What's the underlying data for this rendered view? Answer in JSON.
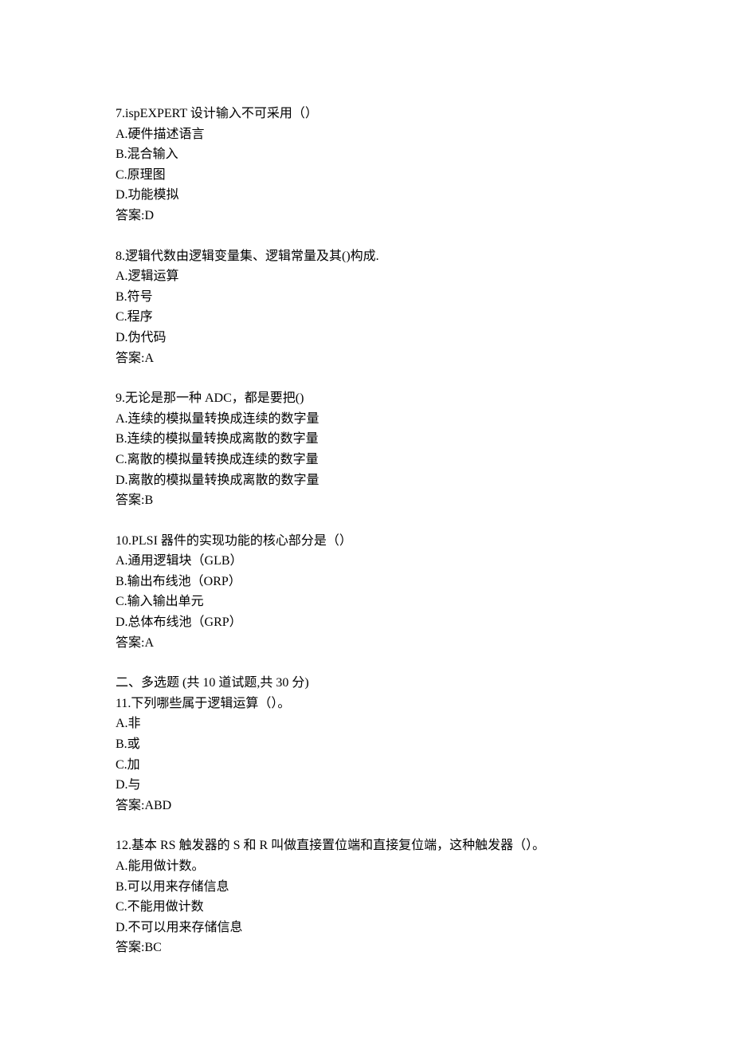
{
  "questions": [
    {
      "number": "7",
      "stem": "7.ispEXPERT 设计输入不可采用（）",
      "options": [
        "A.硬件描述语言",
        "B.混合输入",
        "C.原理图",
        "D.功能模拟"
      ],
      "answer_label": "答案:D"
    },
    {
      "number": "8",
      "stem": "8.逻辑代数由逻辑变量集、逻辑常量及其()构成.",
      "options": [
        "A.逻辑运算",
        "B.符号",
        "C.程序",
        "D.伪代码"
      ],
      "answer_label": "答案:A"
    },
    {
      "number": "9",
      "stem": "9.无论是那一种 ADC，都是要把()",
      "options": [
        "A.连续的模拟量转换成连续的数字量",
        "B.连续的模拟量转换成离散的数字量",
        "C.离散的模拟量转换成连续的数字量",
        "D.离散的模拟量转换成离散的数字量"
      ],
      "answer_label": "答案:B"
    },
    {
      "number": "10",
      "stem": "10.PLSI 器件的实现功能的核心部分是（）",
      "options": [
        "A.通用逻辑块（GLB）",
        "B.输出布线池（ORP）",
        "C.输入输出单元",
        "D.总体布线池（GRP）"
      ],
      "answer_label": "答案:A"
    }
  ],
  "section_header": "二、多选题 (共 10 道试题,共 30 分)",
  "multi_questions": [
    {
      "number": "11",
      "stem": "11.下列哪些属于逻辑运算（）。",
      "options": [
        "A.非",
        "B.或",
        "C.加",
        "D.与"
      ],
      "answer_label": "答案:ABD"
    },
    {
      "number": "12",
      "stem": "12.基本 RS 触发器的 S 和 R 叫做直接置位端和直接复位端，这种触发器（）。",
      "options": [
        "A.能用做计数。",
        "B.可以用来存储信息",
        "C.不能用做计数",
        "D.不可以用来存储信息"
      ],
      "answer_label": "答案:BC"
    }
  ]
}
